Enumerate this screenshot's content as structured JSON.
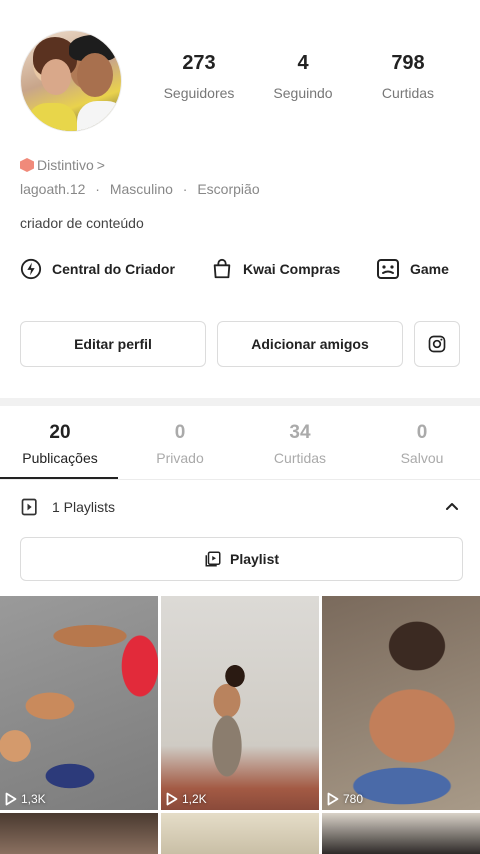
{
  "profile": {
    "stats": [
      {
        "value": "273",
        "label": "Seguidores"
      },
      {
        "value": "4",
        "label": "Seguindo"
      },
      {
        "value": "798",
        "label": "Curtidas"
      }
    ],
    "badge": "Distintivo",
    "badge_chevron": ">",
    "username": "lagoath.12",
    "separator": "·",
    "gender": "Masculino",
    "sign": "Escorpião",
    "bio": "criador de conteúdo"
  },
  "shortcuts": [
    {
      "label": "Central do Criador",
      "icon": "lightning-circle-icon"
    },
    {
      "label": "Kwai Compras",
      "icon": "shopping-bag-icon"
    },
    {
      "label": "Game",
      "icon": "gamepad-icon"
    }
  ],
  "buttons": {
    "edit_profile": "Editar perfil",
    "add_friends": "Adicionar amigos",
    "instagram_icon": "instagram-icon"
  },
  "tabs": [
    {
      "count": "20",
      "label": "Publicações",
      "active": true
    },
    {
      "count": "0",
      "label": "Privado"
    },
    {
      "count": "34",
      "label": "Curtidas"
    },
    {
      "count": "0",
      "label": "Salvou"
    }
  ],
  "playlists": {
    "summary": "1 Playlists",
    "button_label": "Playlist"
  },
  "videos": [
    {
      "views": "1,3K"
    },
    {
      "views": "1,2K"
    },
    {
      "views": "780"
    }
  ]
}
